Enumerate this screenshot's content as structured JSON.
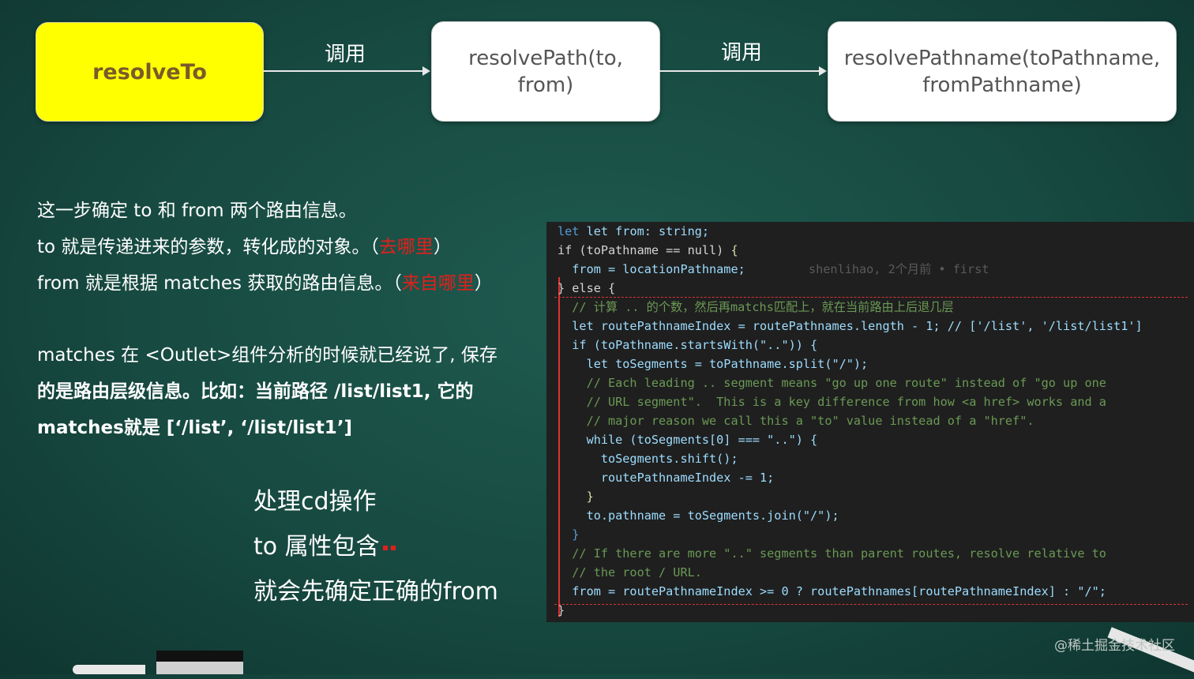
{
  "flow": {
    "box1": "resolveTo",
    "call1": "调用",
    "box2_line1": "resolvePath(to,",
    "box2_line2": "from)",
    "call2": "调用",
    "box3_line1": "resolvePathname(toPathname,",
    "box3_line2": "fromPathname)"
  },
  "text": {
    "l1": "这一步确定 to 和 from 两个路由信息。",
    "l2a": "to 就是传递进来的参数，转化成的对象。（",
    "l2b": "去哪里",
    "l2c": "）",
    "l3a": "from 就是根据 matches 获取的路由信息。（",
    "l3b": "来自哪里",
    "l3c": "）",
    "l4": "matches 在 <Outlet>组件分析的时候就已经说了, 保存",
    "l5": "的是路由层级信息。比如：当前路径 /list/list1, 它的",
    "l6": "matches就是 [‘/list’, ‘/list/list1’]",
    "b1": "处理cd操作",
    "b2": "to 属性包含",
    "b3": "就会先确定正确的from"
  },
  "code": {
    "c1": "let from: string;",
    "c2a": "if (toPathname == null) ",
    "c2b": "{",
    "c3": "  from = locationPathname;",
    "c3blame": "shenlihao, 2个月前 • first",
    "c4": "} else {",
    "c5": "  // 计算 .. 的个数，然后再matchs匹配上，就在当前路由上后退几层",
    "c6": "  let routePathnameIndex = routePathnames.length - 1; // ['/list', '/list/list1']",
    "c7": "  if (toPathname.startsWith(\"..\")) {",
    "c8": "    let toSegments = toPathname.split(\"/\");",
    "c9": "    // Each leading .. segment means \"go up one route\" instead of \"go up one",
    "c10": "    // URL segment\".  This is a key difference from how <a href> works and a",
    "c11": "    // major reason we call this a \"to\" value instead of a \"href\".",
    "c12": "    while (toSegments[0] === \"..\") {",
    "c13": "      toSegments.shift();",
    "c14": "      routePathnameIndex -= 1;",
    "c15": "    }",
    "c16": "    to.pathname = toSegments.join(\"/\");",
    "c17": "  }",
    "c18": "  // If there are more \"..\" segments than parent routes, resolve relative to",
    "c19": "  // the root / URL.",
    "c20": "  from = routePathnameIndex >= 0 ? routePathnames[routePathnameIndex] : \"/\";",
    "c21": "}"
  },
  "watermark": "@稀土掘金技术社区",
  "colors": {
    "accent_yellow": "#ffff00",
    "highlight_red": "#e0201b",
    "board_green": "#174a41"
  }
}
